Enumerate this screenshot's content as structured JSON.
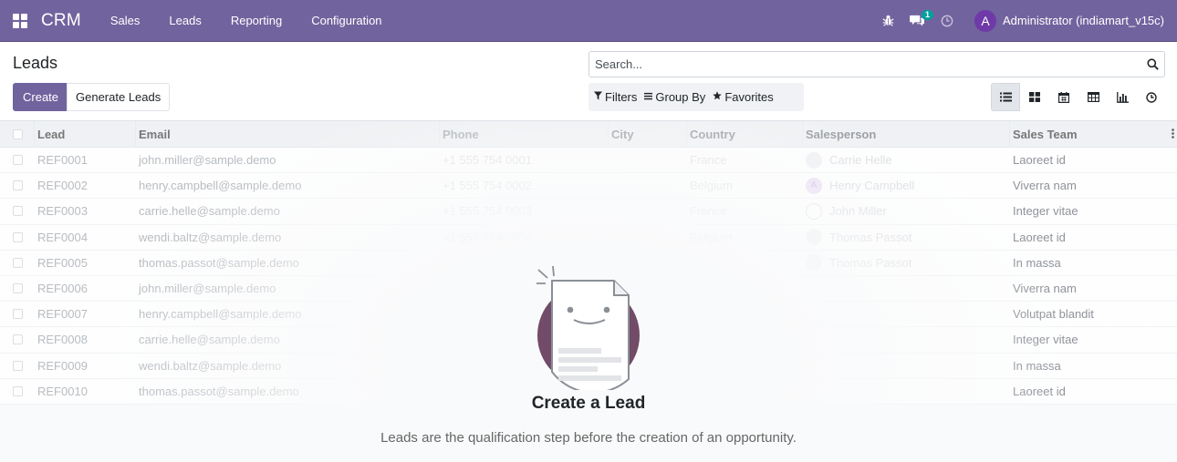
{
  "navbar": {
    "app_name": "CRM",
    "menu": [
      "Sales",
      "Leads",
      "Reporting",
      "Configuration"
    ],
    "messages_badge": "1",
    "user_initial": "A",
    "user_name": "Administrator (indiamart_v15c)",
    "bg_color": "#71639e"
  },
  "control": {
    "title": "Leads",
    "create_label": "Create",
    "generate_label": "Generate Leads",
    "search_placeholder": "Search...",
    "filters_label": "Filters",
    "groupby_label": "Group By",
    "favorites_label": "Favorites",
    "views": [
      "list-view-icon",
      "kanban-view-icon",
      "calendar-view-icon",
      "pivot-view-icon",
      "graph-view-icon",
      "activity-view-icon"
    ]
  },
  "table": {
    "columns": [
      "Lead",
      "Email",
      "Phone",
      "City",
      "Country",
      "Salesperson",
      "Sales Team"
    ],
    "rows": [
      {
        "lead": "REF0001",
        "email": "john.miller@sample.demo",
        "phone": "+1 555 754 0001",
        "city": "",
        "country": "France",
        "salesperson": "Carrie Helle",
        "team": "Laoreet id"
      },
      {
        "lead": "REF0002",
        "email": "henry.campbell@sample.demo",
        "phone": "+1 555 754 0002",
        "city": "",
        "country": "Belgium",
        "salesperson": "Henry Campbell",
        "team": "Viverra nam"
      },
      {
        "lead": "REF0003",
        "email": "carrie.helle@sample.demo",
        "phone": "+1 555 754 0003",
        "city": "",
        "country": "France",
        "salesperson": "John Miller",
        "team": "Integer vitae"
      },
      {
        "lead": "REF0004",
        "email": "wendi.baltz@sample.demo",
        "phone": "+1 555 754 0004",
        "city": "",
        "country": "Belgium",
        "salesperson": "Thomas Passot",
        "team": "Laoreet id"
      },
      {
        "lead": "REF0005",
        "email": "thomas.passot@sample.demo",
        "phone": "",
        "city": "",
        "country": "",
        "salesperson": "Thomas Passot",
        "team": "In massa"
      },
      {
        "lead": "REF0006",
        "email": "john.miller@sample.demo",
        "phone": "",
        "city": "",
        "country": "",
        "salesperson": "",
        "team": "Viverra nam"
      },
      {
        "lead": "REF0007",
        "email": "henry.campbell@sample.demo",
        "phone": "",
        "city": "",
        "country": "",
        "salesperson": "",
        "team": "Volutpat blandit"
      },
      {
        "lead": "REF0008",
        "email": "carrie.helle@sample.demo",
        "phone": "",
        "city": "",
        "country": "",
        "salesperson": "",
        "team": "Integer vitae"
      },
      {
        "lead": "REF0009",
        "email": "wendi.baltz@sample.demo",
        "phone": "",
        "city": "",
        "country": "",
        "salesperson": "",
        "team": "In massa"
      },
      {
        "lead": "REF0010",
        "email": "thomas.passot@sample.demo",
        "phone": "",
        "city": "",
        "country": "",
        "salesperson": "",
        "team": "Laoreet id"
      }
    ]
  },
  "help": {
    "title": "Create a Lead",
    "text": "Leads are the qualification step before the creation of an opportunity."
  }
}
